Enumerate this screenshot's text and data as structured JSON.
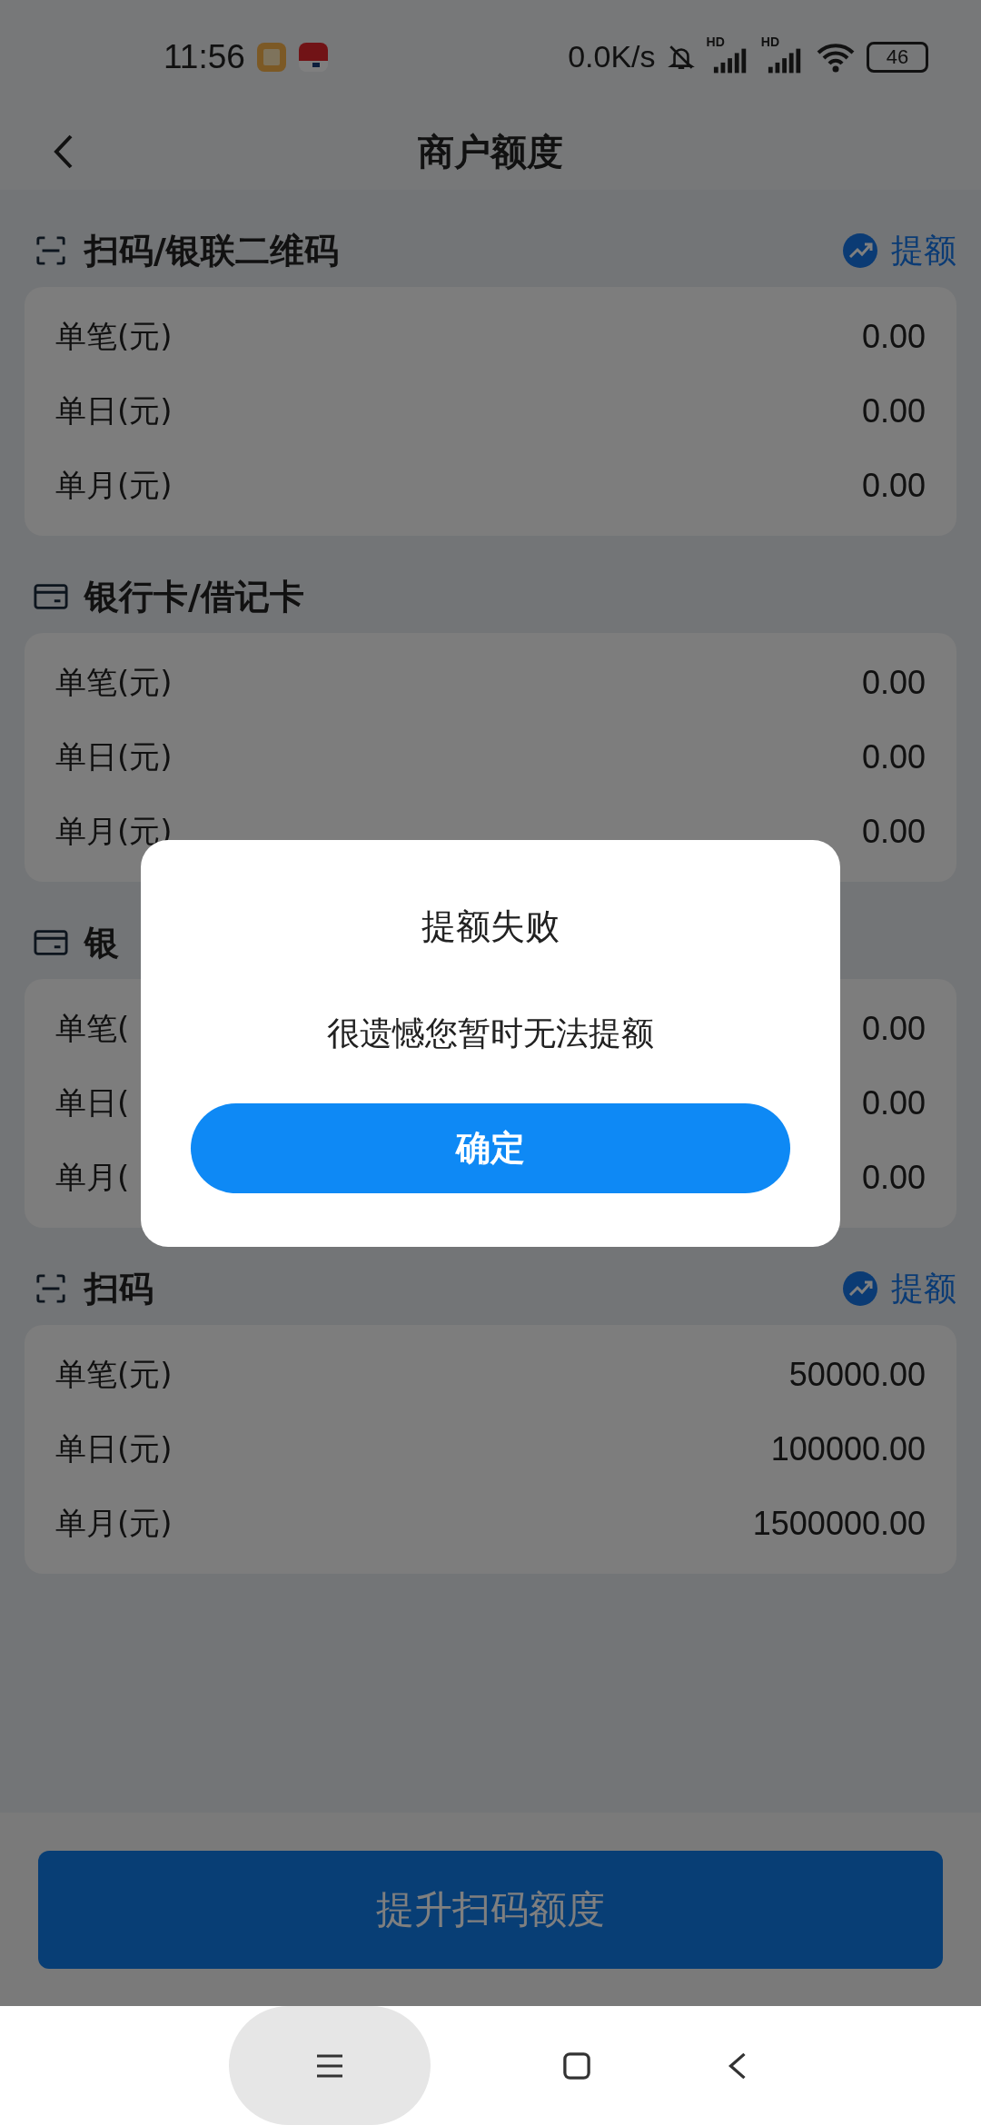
{
  "status_bar": {
    "time": "11:56",
    "net_speed": "0.0K/s",
    "signal_labels": [
      "HD",
      "HD"
    ],
    "battery": "46"
  },
  "header": {
    "title": "商户额度"
  },
  "sections": [
    {
      "kind": "scan",
      "title": "扫码/银联二维码",
      "action": "提额",
      "rows": [
        {
          "label": "单笔(元)",
          "value": "0.00"
        },
        {
          "label": "单日(元)",
          "value": "0.00"
        },
        {
          "label": "单月(元)",
          "value": "0.00"
        }
      ]
    },
    {
      "kind": "card",
      "title": "银行卡/借记卡",
      "rows": [
        {
          "label": "单笔(元)",
          "value": "0.00"
        },
        {
          "label": "单日(元)",
          "value": "0.00"
        },
        {
          "label": "单月(元)",
          "value": "0.00"
        }
      ]
    },
    {
      "kind": "card",
      "title": "银",
      "rows": [
        {
          "label": "单笔(",
          "value": "0.00"
        },
        {
          "label": "单日(",
          "value": "0.00"
        },
        {
          "label": "单月(",
          "value": "0.00"
        }
      ]
    },
    {
      "kind": "scan",
      "title": "扫码",
      "action": "提额",
      "rows": [
        {
          "label": "单笔(元)",
          "value": "50000.00"
        },
        {
          "label": "单日(元)",
          "value": "100000.00"
        },
        {
          "label": "单月(元)",
          "value": "1500000.00"
        }
      ]
    }
  ],
  "bottom_button": "提升扫码额度",
  "dialog": {
    "title": "提额失败",
    "message": "很遗憾您暂时无法提额",
    "button": "确定"
  }
}
